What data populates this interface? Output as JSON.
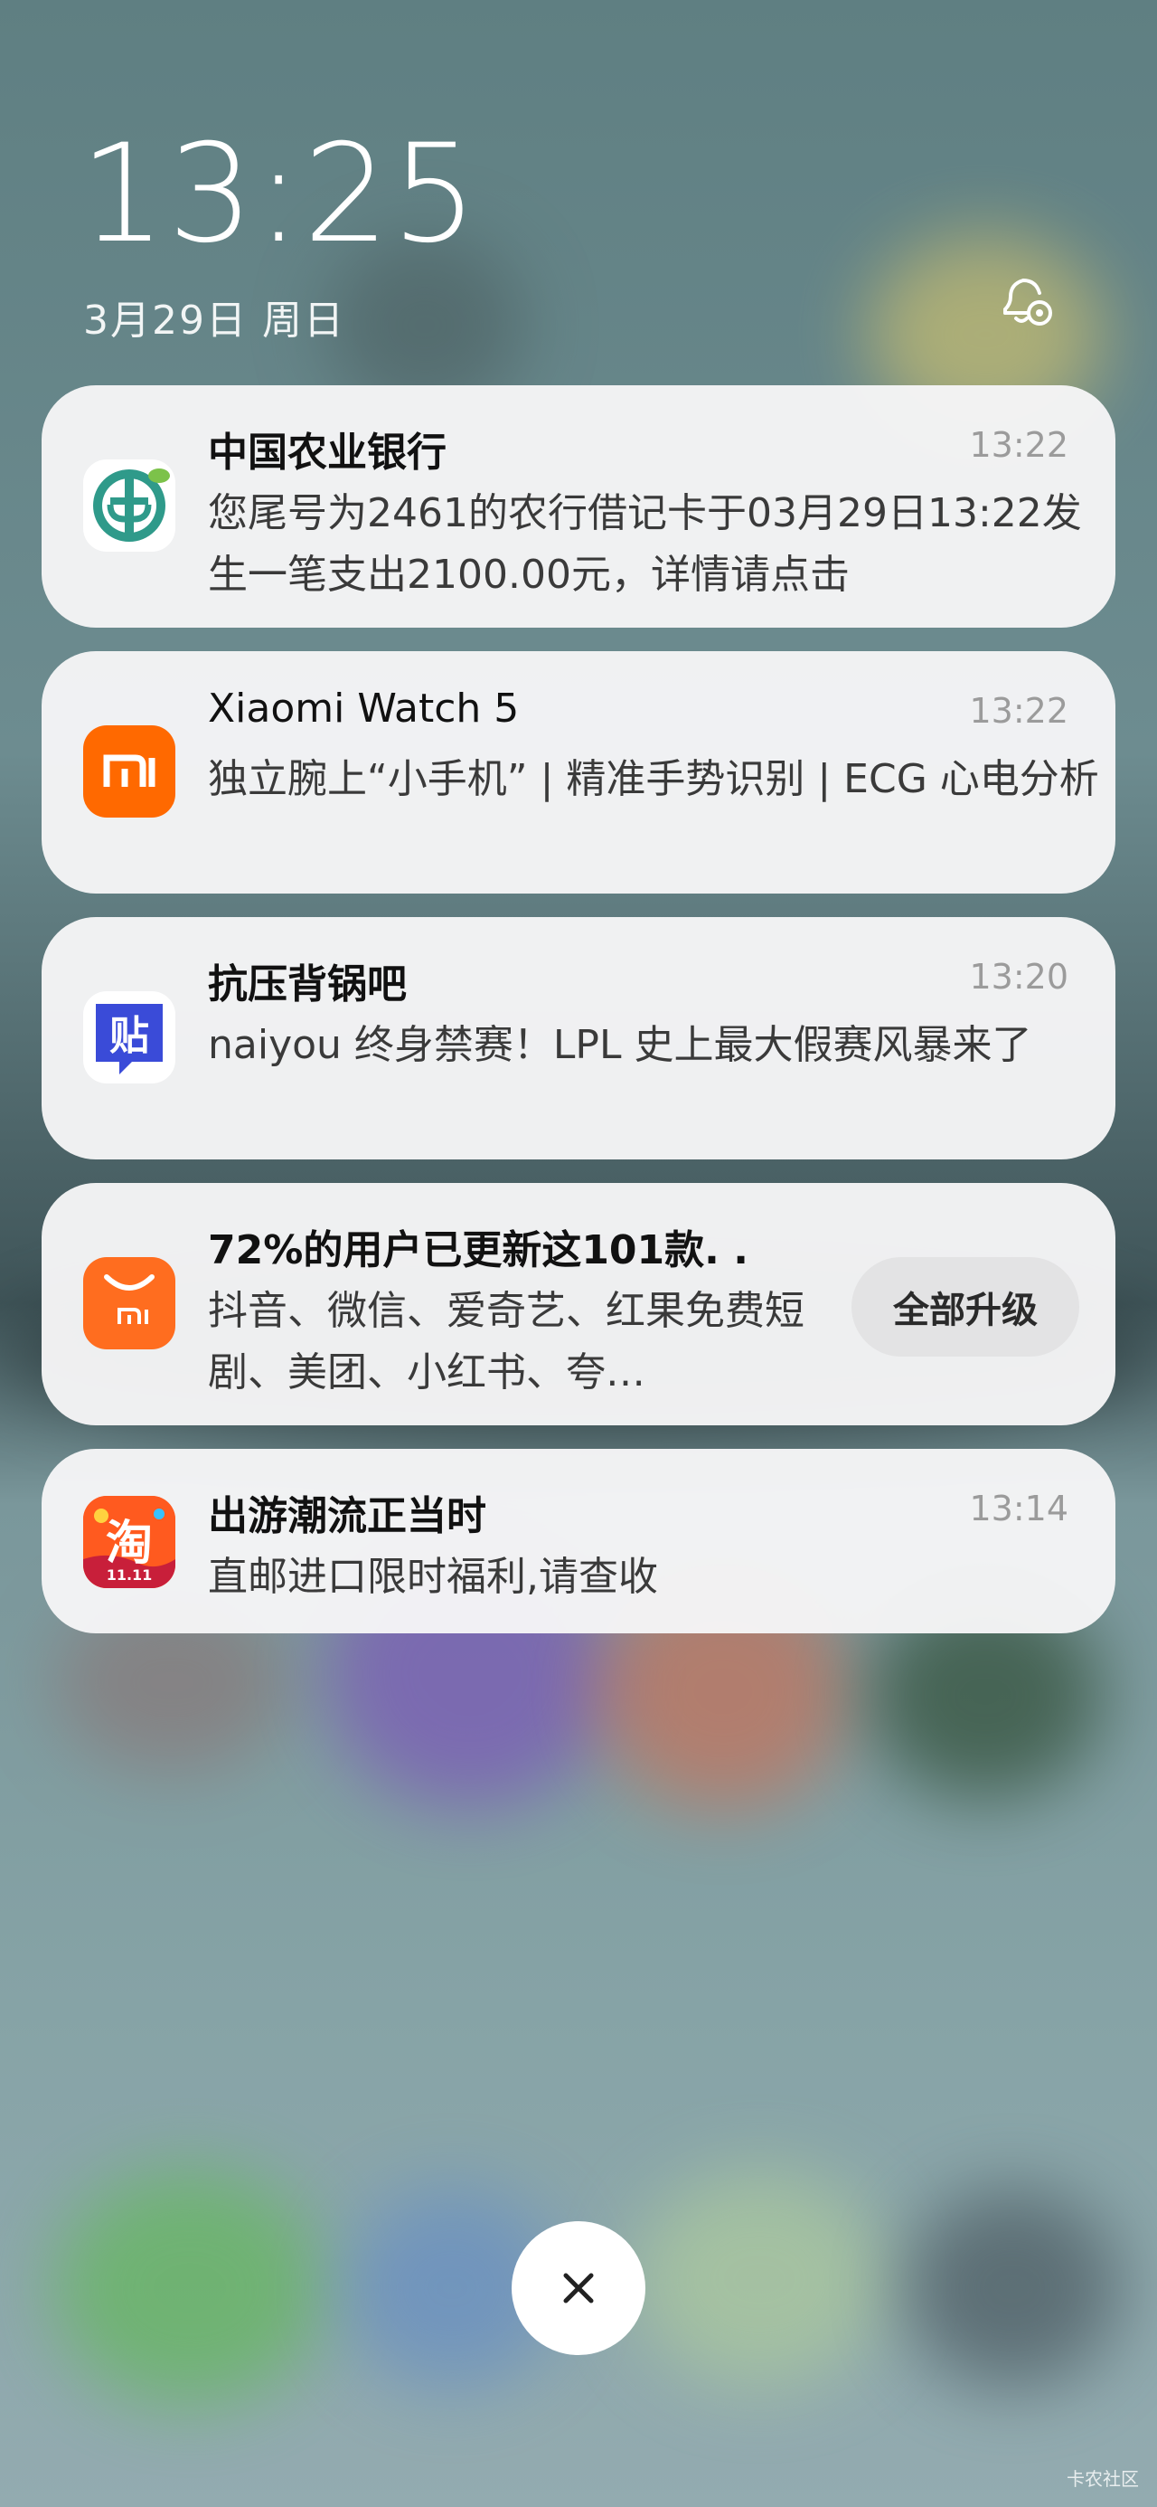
{
  "lockscreen": {
    "time": "13:25",
    "date": "3月29日 周日"
  },
  "notifications": [
    {
      "app_icon": "abc-bank-icon",
      "title": "中国农业银行",
      "time": "13:22",
      "body": "您尾号为2461的农行借记卡于03月29日13:22发生一笔支出2100.00元，详情请点击"
    },
    {
      "app_icon": "mi-icon",
      "title": "Xiaomi Watch 5",
      "time": "13:22",
      "body": "独立腕上“小手机” | 精准手势识别 | ECG 心电分析"
    },
    {
      "app_icon": "tieba-icon",
      "title": "抗压背锅吧",
      "time": "13:20",
      "body": "naiyou 终身禁赛！LPL 史上最大假赛风暴来了"
    },
    {
      "app_icon": "mi-store-icon",
      "title": "72%的用户已更新这101款. .",
      "body": "抖音、微信、爱奇艺、红果免费短剧、美团、小红书、夸…",
      "action_label": "全部升级"
    },
    {
      "app_icon": "taobao-icon",
      "title": "出游潮流正当时",
      "time": "13:14",
      "body": "直邮进口限时福利,请查收",
      "icon_caption": "11.11",
      "icon_char": "淘"
    }
  ],
  "close_icon": "close-icon",
  "bell_icon": "bell-settings-icon",
  "watermark": "卡农社区",
  "colors": {
    "card_bg": "#f5f5f6",
    "mi_orange": "#ff6900",
    "abc_green": "#2f9a8a",
    "tieba_blue": "#3a4bd8",
    "taobao_orange": "#ff5a1f"
  }
}
